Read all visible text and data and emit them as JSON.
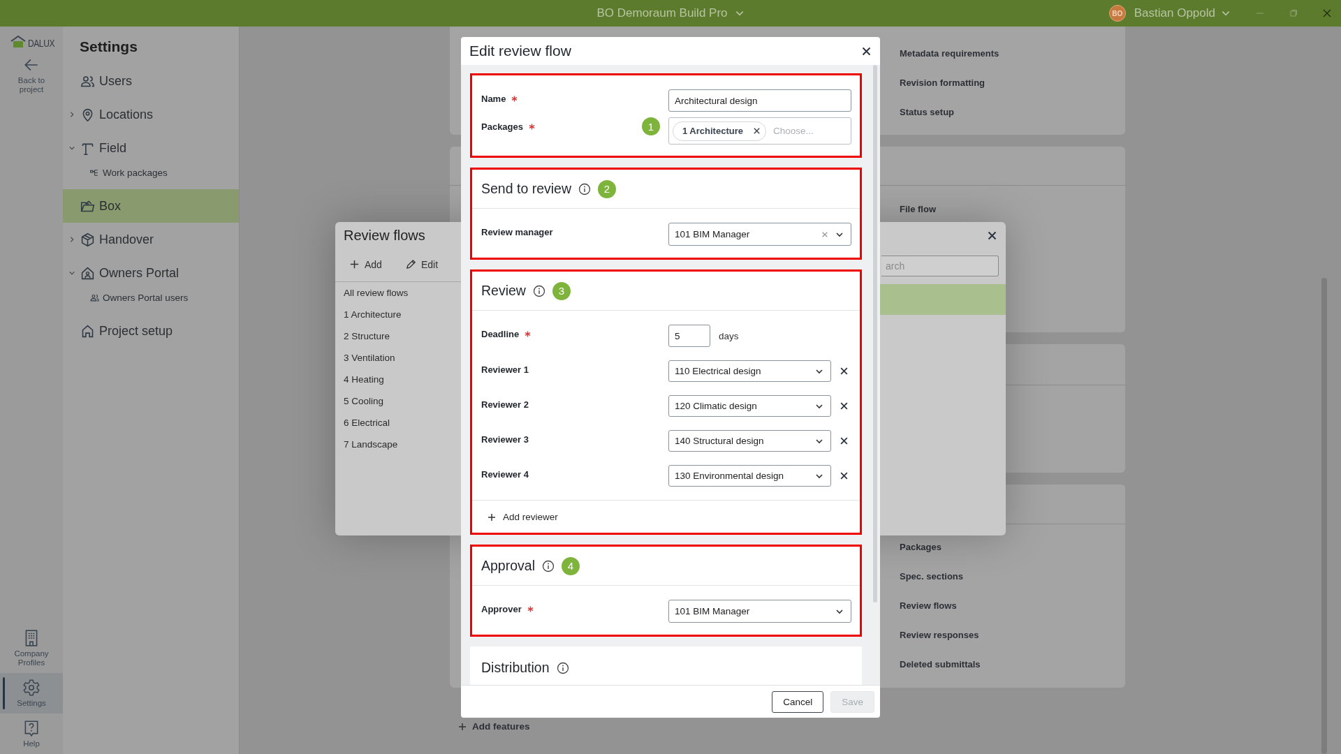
{
  "title_bar": {
    "app_title": "BO Demoraum Build Pro",
    "user_initials": "BO",
    "user_name": "Bastian Oppold"
  },
  "nav_rail": {
    "logo": "DALUX",
    "back": "Back to project",
    "items": [
      {
        "kind": "company",
        "label": "Company Profiles",
        "selected": false
      },
      {
        "kind": "settings",
        "label": "Settings",
        "selected": true
      },
      {
        "kind": "help",
        "label": "Help",
        "selected": false
      }
    ]
  },
  "settings_menu": {
    "title": "Settings",
    "items": [
      {
        "kind": "users",
        "label": "Users",
        "selected": false
      },
      {
        "kind": "location",
        "label": "Locations",
        "selected": false,
        "expanded": false
      },
      {
        "kind": "field",
        "label": "Field",
        "selected": false,
        "expanded": true,
        "children": [
          {
            "kind": "packages",
            "label": "Work packages"
          }
        ]
      },
      {
        "kind": "box",
        "label": "Box",
        "selected": true
      },
      {
        "kind": "handover",
        "label": "Handover",
        "selected": false,
        "expanded": false
      },
      {
        "kind": "portal",
        "label": "Owners Portal",
        "selected": false,
        "expanded": true,
        "children": [
          {
            "kind": "users",
            "label": "Owners Portal users"
          }
        ]
      },
      {
        "kind": "home",
        "label": "Project setup",
        "selected": false
      }
    ]
  },
  "settings_cards": [
    {
      "header": false,
      "items": [
        "Metadata requirements",
        "Revision formatting",
        "Status setup"
      ]
    },
    {
      "header": true,
      "items": [
        "File flow"
      ]
    },
    {
      "header": true
    },
    {
      "header": true,
      "items": [
        "Packages",
        "Spec. sections",
        "Review flows",
        "Review responses",
        "Deleted submittals"
      ]
    }
  ],
  "add_features": "Add features",
  "review_flows_dialog": {
    "title": "Review flows",
    "actions": [
      {
        "kind": "add",
        "label": "Add"
      },
      {
        "kind": "edit",
        "label": "Edit"
      }
    ],
    "items": [
      "All review flows",
      "1 Architecture",
      "2 Structure",
      "3 Ventilation",
      "4 Heating",
      "5 Cooling",
      "6 Electrical",
      "7 Landscape"
    ],
    "search_placeholder": "arch"
  },
  "edit_dialog": {
    "title": "Edit review flow",
    "general": {
      "highlighted": true,
      "marker": "1",
      "name": {
        "label": "Name",
        "required": true,
        "value": "Architectural design"
      },
      "packages": {
        "label": "Packages",
        "required": true,
        "chips": [
          "1 Architecture"
        ],
        "placeholder": "Choose..."
      }
    },
    "send_to_review": {
      "highlighted": true,
      "title": "Send to review",
      "marker": "2",
      "review_manager": {
        "label": "Review manager",
        "required": false,
        "value": "101 BIM Manager",
        "clearable": true
      }
    },
    "review": {
      "highlighted": true,
      "title": "Review",
      "marker": "3",
      "deadline": {
        "label": "Deadline",
        "required": true,
        "value": "5",
        "unit": "days"
      },
      "reviewers": [
        {
          "label": "Reviewer 1",
          "value": "110 Electrical design"
        },
        {
          "label": "Reviewer 2",
          "value": "120 Climatic design"
        },
        {
          "label": "Reviewer 3",
          "value": "140 Structural design"
        },
        {
          "label": "Reviewer 4",
          "value": "130 Environmental design"
        }
      ],
      "add_reviewer": "Add reviewer"
    },
    "approval": {
      "highlighted": true,
      "title": "Approval",
      "marker": "4",
      "approver": {
        "label": "Approver",
        "required": true,
        "value": "101 BIM Manager",
        "clearable": false
      }
    },
    "distribution": {
      "highlighted": false,
      "title": "Distribution"
    },
    "buttons": [
      {
        "label": "Cancel",
        "disabled": false
      },
      {
        "label": "Save",
        "disabled": true
      }
    ]
  }
}
